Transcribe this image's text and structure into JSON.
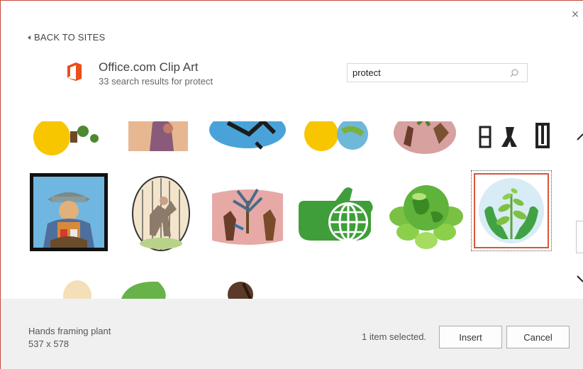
{
  "dialog": {
    "close_symbol": "×",
    "back_label": "BACK TO SITES"
  },
  "provider": {
    "logo": "office-logo-icon",
    "brand_color": "#e94e1b",
    "title": "Office.com Clip Art",
    "subtitle": "33 search results for protect"
  },
  "search": {
    "value": "protect",
    "icon": "search-icon"
  },
  "results": {
    "selected_index": 11,
    "selection_color": "#d4573b"
  },
  "footer": {
    "item_title": "Hands framing plant",
    "item_size": "537 x 578",
    "status": "1 item selected.",
    "insert_label": "Insert",
    "cancel_label": "Cancel"
  }
}
